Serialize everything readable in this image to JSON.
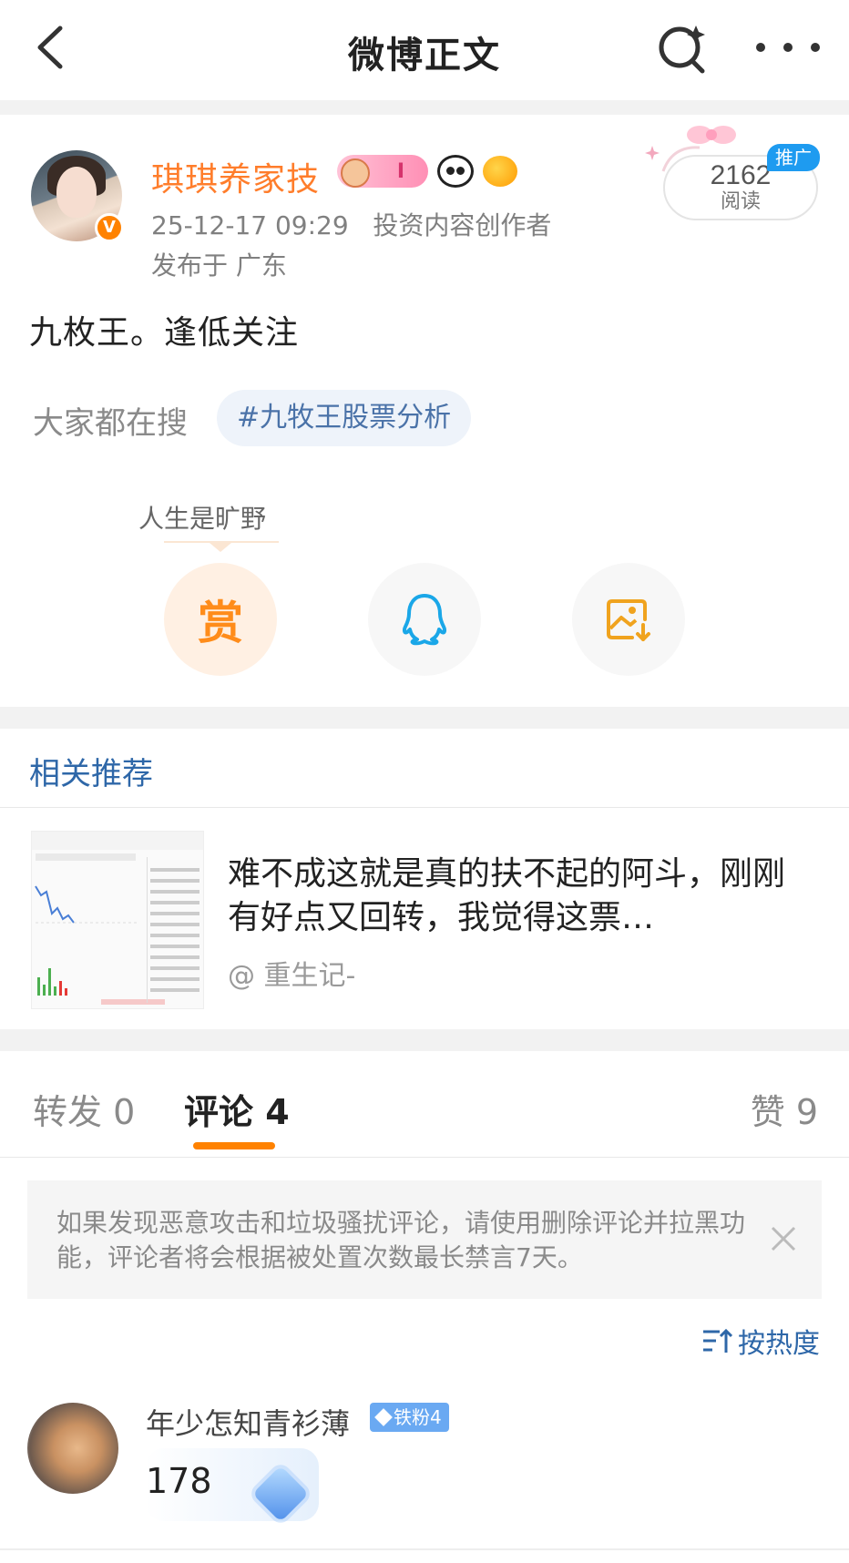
{
  "header": {
    "title": "微博正文",
    "back_icon": "chevron-left-icon",
    "search_icon": "search-sparkle-icon",
    "more_icon": "more-dots-icon"
  },
  "post": {
    "author": "琪琪养家技",
    "level_badge": "I",
    "timestamp": "25-12-17 09:29",
    "author_title": "投资内容创作者",
    "location": "发布于 广东",
    "read_count": "2162",
    "read_label": "阅读",
    "promo_tag": "推广",
    "text": "九枚王。逢低关注",
    "search_label": "大家都在搜",
    "topic": "#九牧王股票分析",
    "reward_user": "人生是旷野",
    "reward_label": "赏"
  },
  "related": {
    "section_title": "相关推荐",
    "item_text": "难不成这就是真的扶不起的阿斗，刚刚有好点又回转，我觉得这票…",
    "item_source": "@ 重生记-"
  },
  "tabs": {
    "forward": "转发 0",
    "comment": "评论 4",
    "like": "赞 9"
  },
  "notice": {
    "text": "如果发现恶意攻击和垃圾骚扰评论，请使用删除评论并拉黑功能，评论者将会根据被处置次数最长禁言7天。"
  },
  "sort": {
    "label": "按热度"
  },
  "comment": {
    "user": "年少怎知青衫薄",
    "fan_badge": "铁粉4",
    "text": "178"
  },
  "colors": {
    "accent_orange": "#ff8200",
    "link_blue": "#2e67a8",
    "author_orange": "#ff7d2b"
  }
}
